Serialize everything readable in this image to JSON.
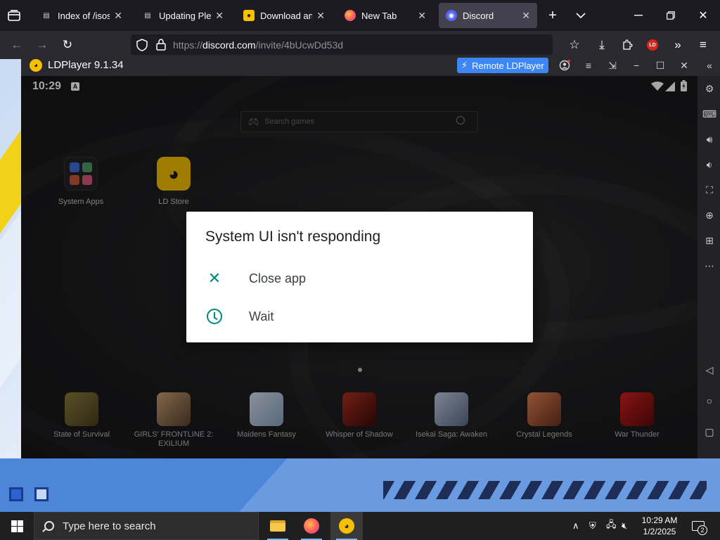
{
  "browser": {
    "tabs": [
      {
        "label": "Index of /isos/w",
        "icon": "file-icon",
        "active": false
      },
      {
        "label": "Updating Please",
        "icon": "file-icon",
        "active": false
      },
      {
        "label": "Download and I",
        "icon": "ldplayer-icon",
        "active": false
      },
      {
        "label": "New Tab",
        "icon": "firefox-icon",
        "active": false
      },
      {
        "label": "Discord",
        "icon": "discord-icon",
        "active": true
      }
    ],
    "url_scheme": "https://",
    "url_host": "discord.com",
    "url_path": "/invite/4bUcwDd53d"
  },
  "ldplayer": {
    "title": "LDPlayer 9.1.34",
    "remote_button": "Remote LDPlayer",
    "accent": "#3d86f5"
  },
  "android": {
    "time": "10:29",
    "search_placeholder": "Search games",
    "apps": [
      {
        "label": "System Apps"
      },
      {
        "label": "LD Store"
      }
    ],
    "games": [
      {
        "label": "State of Survival",
        "color": "#6b6030"
      },
      {
        "label": "GIRLS' FRONTLINE 2: EXILIUM",
        "color": "#8a7050"
      },
      {
        "label": "Maidens Fantasy",
        "color": "#b0c4d8"
      },
      {
        "label": "Whisper of Shadow",
        "color": "#7a2018"
      },
      {
        "label": "Isekai Saga: Awaken",
        "color": "#9aa8c0"
      },
      {
        "label": "Crystal Legends",
        "color": "#c06040"
      },
      {
        "label": "War Thunder",
        "color": "#b01818"
      }
    ],
    "dialog": {
      "title": "System UI isn't responding",
      "options": [
        {
          "label": "Close app",
          "icon": "close-icon"
        },
        {
          "label": "Wait",
          "icon": "clock-icon"
        }
      ],
      "accent": "#00897b"
    }
  },
  "taskbar": {
    "search_placeholder": "Type here to search",
    "time": "10:29 AM",
    "date": "1/2/2025",
    "notification_count": "2"
  }
}
